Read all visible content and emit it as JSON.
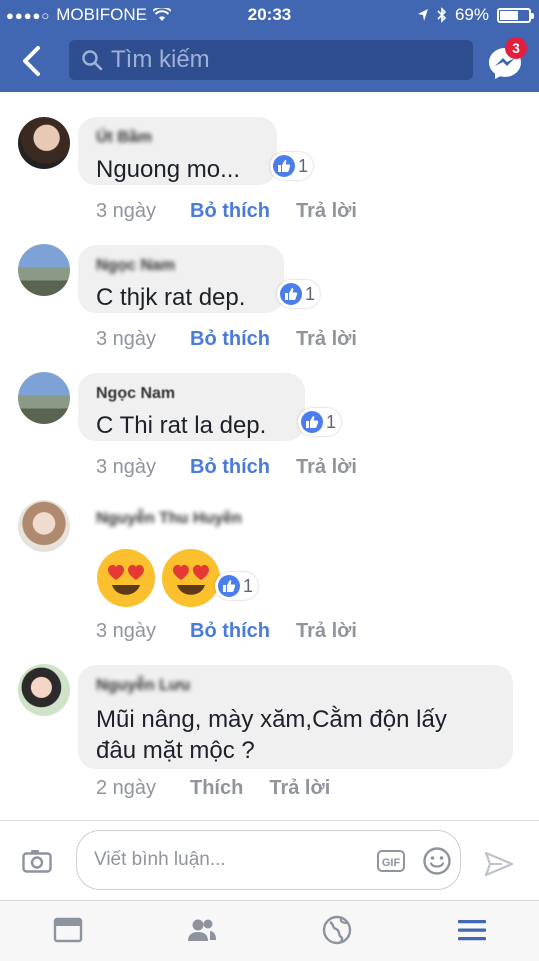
{
  "status_bar": {
    "carrier": "MOBIFONE",
    "time": "20:33",
    "battery_text": "69%",
    "battery_level": 0.69
  },
  "navbar": {
    "search_placeholder": "Tìm kiếm",
    "messenger_badge": "3"
  },
  "comments": [
    {
      "name": "Út Bầm",
      "text": "Nguong mo...",
      "likes": "1",
      "time": "3 ngày",
      "like_label": "Bỏ thích",
      "reply_label": "Trả lời"
    },
    {
      "name": "Ngọc Nam",
      "text": "C thjk rat dep.",
      "likes": "1",
      "time": "3 ngày",
      "like_label": "Bỏ thích",
      "reply_label": "Trả lời"
    },
    {
      "name": "Ngọc Nam",
      "text": "C Thi rat la dep.",
      "likes": "1",
      "time": "3 ngày",
      "like_label": "Bỏ thích",
      "reply_label": "Trả lời"
    },
    {
      "name": "Nguyễn Thu Huyền",
      "text": "",
      "likes": "1",
      "time": "3 ngày",
      "like_label": "Bỏ thích",
      "reply_label": "Trả lời"
    },
    {
      "name": "Nguyễn Lưu",
      "text_line1": "Mũi nâng, mày xăm,Cằm độn  lấy",
      "text_line2": "đâu mặt  mộc ?",
      "time": "2 ngày",
      "like_label": "Thích",
      "reply_label": "Trả lời"
    }
  ],
  "composer": {
    "placeholder": "Viết bình luận...",
    "gif_label": "GIF"
  },
  "icons": {
    "back": "chevron-left-icon",
    "search": "search-icon",
    "messenger": "messenger-icon",
    "camera": "camera-icon",
    "gif": "gif-icon",
    "emoji": "smiley-icon",
    "send": "send-icon",
    "news_feed": "news-feed-icon",
    "friends": "friends-icon",
    "globe": "globe-icon",
    "menu": "menu-icon"
  },
  "colors": {
    "brand": "#4267b2",
    "like_active": "#4a7cd9",
    "badge": "#e41e3f"
  }
}
